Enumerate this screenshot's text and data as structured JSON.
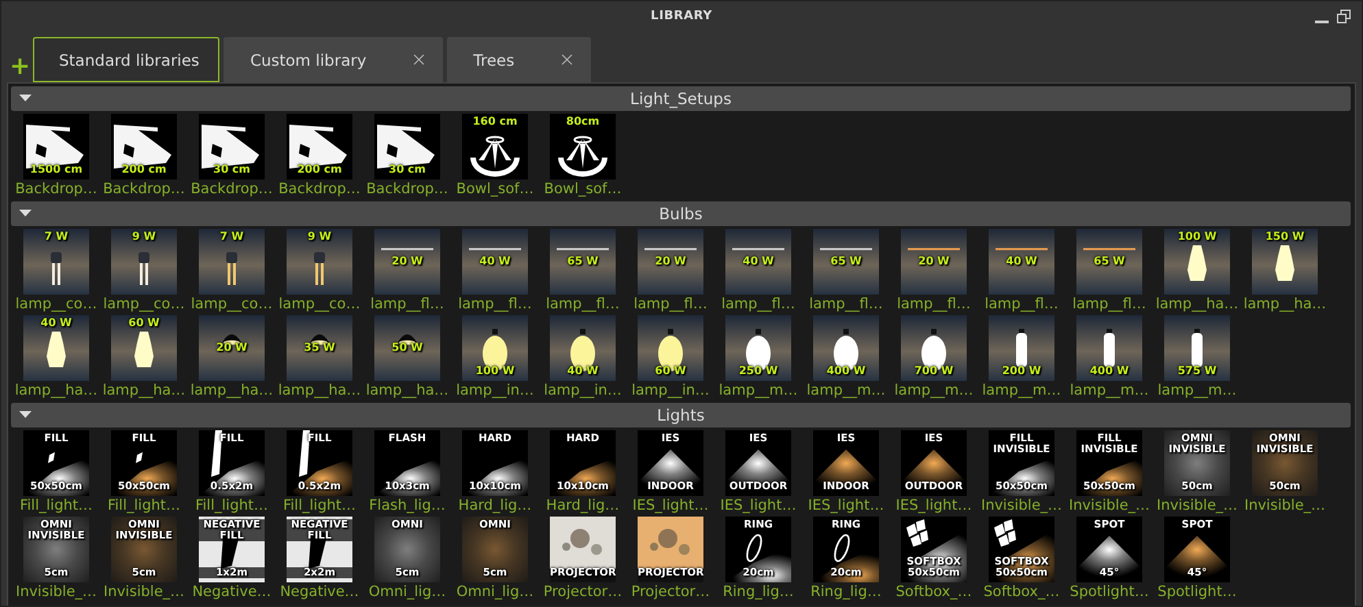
{
  "window": {
    "title": "LIBRARY"
  },
  "add_tab": "+",
  "tabs": [
    {
      "label": "Standard libraries",
      "selected": true,
      "closable": false
    },
    {
      "label": "Custom library",
      "selected": false,
      "closable": true
    },
    {
      "label": "Trees",
      "selected": false,
      "closable": true
    }
  ],
  "sections": [
    {
      "title": "Light_Setups",
      "expanded": true,
      "items": [
        {
          "label": "Backdrop…",
          "kind": "backdrop",
          "warm": false,
          "bottom": "1500 cm"
        },
        {
          "label": "Backdrop…",
          "kind": "backdrop",
          "warm": false,
          "bottom": "200 cm"
        },
        {
          "label": "Backdrop…",
          "kind": "backdrop",
          "warm": false,
          "bottom": "30 cm"
        },
        {
          "label": "Backdrop…",
          "kind": "backdrop",
          "warm": false,
          "bottom": "200 cm"
        },
        {
          "label": "Backdrop…",
          "kind": "backdrop",
          "warm": false,
          "bottom": "30 cm"
        },
        {
          "label": "Bowl_sof…",
          "kind": "bowl",
          "warm": false,
          "top": "160 cm"
        },
        {
          "label": "Bowl_sof…",
          "kind": "bowl",
          "warm": false,
          "top": "80cm"
        }
      ]
    },
    {
      "title": "Bulbs",
      "expanded": true,
      "items": [
        {
          "label": "lamp__co…",
          "kind": "cfl",
          "warm": false,
          "top": "7 W"
        },
        {
          "label": "lamp__co…",
          "kind": "cfl",
          "warm": false,
          "top": "9 W"
        },
        {
          "label": "lamp__co…",
          "kind": "cfl",
          "warm": true,
          "top": "7 W"
        },
        {
          "label": "lamp__co…",
          "kind": "cfl",
          "warm": true,
          "top": "9 W"
        },
        {
          "label": "lamp__fl…",
          "kind": "tube",
          "warm": false,
          "middle": "20 W"
        },
        {
          "label": "lamp__fl…",
          "kind": "tube",
          "warm": false,
          "middle": "40 W"
        },
        {
          "label": "lamp__fl…",
          "kind": "tube",
          "warm": false,
          "middle": "65 W"
        },
        {
          "label": "lamp__fl…",
          "kind": "tube",
          "warm": false,
          "middle": "20 W"
        },
        {
          "label": "lamp__fl…",
          "kind": "tube",
          "warm": false,
          "middle": "40 W"
        },
        {
          "label": "lamp__fl…",
          "kind": "tube",
          "warm": false,
          "middle": "65 W"
        },
        {
          "label": "lamp__fl…",
          "kind": "tube",
          "warm": true,
          "middle": "20 W"
        },
        {
          "label": "lamp__fl…",
          "kind": "tube",
          "warm": true,
          "middle": "40 W"
        },
        {
          "label": "lamp__fl…",
          "kind": "tube",
          "warm": true,
          "middle": "65 W"
        },
        {
          "label": "lamp__ha…",
          "kind": "halogen",
          "warm": false,
          "top": "100 W"
        },
        {
          "label": "lamp__ha…",
          "kind": "halogen",
          "warm": false,
          "top": "150 W"
        },
        {
          "label": "lamp__ha…",
          "kind": "halogen",
          "warm": false,
          "top": "40 W"
        },
        {
          "label": "lamp__ha…",
          "kind": "halogen",
          "warm": false,
          "top": "60 W"
        },
        {
          "label": "lamp__ha…",
          "kind": "spotbulb",
          "warm": false,
          "middle": "20 W"
        },
        {
          "label": "lamp__ha…",
          "kind": "spotbulb",
          "warm": false,
          "middle": "35 W"
        },
        {
          "label": "lamp__ha…",
          "kind": "spotbulb",
          "warm": false,
          "middle": "50 W"
        },
        {
          "label": "lamp__in…",
          "kind": "pear",
          "warm": true,
          "bottom": "100 W"
        },
        {
          "label": "lamp__in…",
          "kind": "pear",
          "warm": true,
          "bottom": "40 W"
        },
        {
          "label": "lamp__in…",
          "kind": "pear",
          "warm": true,
          "bottom": "60 W"
        },
        {
          "label": "lamp__m…",
          "kind": "pear",
          "warm": false,
          "bottom": "250 W"
        },
        {
          "label": "lamp__m…",
          "kind": "pear",
          "warm": false,
          "bottom": "400 W"
        },
        {
          "label": "lamp__m…",
          "kind": "pear",
          "warm": false,
          "bottom": "700 W"
        },
        {
          "label": "lamp__m…",
          "kind": "rod",
          "warm": false,
          "bottom": "200 W"
        },
        {
          "label": "lamp__m…",
          "kind": "rod",
          "warm": false,
          "bottom": "400 W"
        },
        {
          "label": "lamp__m…",
          "kind": "rod",
          "warm": false,
          "bottom": "575 W"
        }
      ]
    },
    {
      "title": "Lights",
      "expanded": true,
      "items": [
        {
          "label": "Fill_light…",
          "kind": "panel",
          "warm": false,
          "top": "FILL",
          "bottom": "50x50cm"
        },
        {
          "label": "Fill_light…",
          "kind": "panel",
          "warm": true,
          "top": "FILL",
          "bottom": "50x50cm"
        },
        {
          "label": "Fill_light…",
          "kind": "strip",
          "warm": false,
          "top": "FILL",
          "bottom": "0.5x2m"
        },
        {
          "label": "Fill_light…",
          "kind": "strip",
          "warm": true,
          "top": "FILL",
          "bottom": "0.5x2m"
        },
        {
          "label": "Flash_lig…",
          "kind": "glow",
          "warm": false,
          "top": "FLASH",
          "bottom": "10x3cm"
        },
        {
          "label": "Hard_lig…",
          "kind": "glow",
          "warm": false,
          "top": "HARD",
          "bottom": "10x10cm"
        },
        {
          "label": "Hard_lig…",
          "kind": "glow",
          "warm": true,
          "top": "HARD",
          "bottom": "10x10cm"
        },
        {
          "label": "IES_light…",
          "kind": "cone",
          "warm": false,
          "top": "IES",
          "bottom": "INDOOR"
        },
        {
          "label": "IES_light…",
          "kind": "cone",
          "warm": false,
          "top": "IES",
          "bottom": "OUTDOOR"
        },
        {
          "label": "IES_light…",
          "kind": "cone",
          "warm": true,
          "top": "IES",
          "bottom": "INDOOR"
        },
        {
          "label": "IES_light…",
          "kind": "cone",
          "warm": true,
          "top": "IES",
          "bottom": "OUTDOOR"
        },
        {
          "label": "Invisible_…",
          "kind": "glow",
          "warm": false,
          "top": "FILL INVISIBLE",
          "bottom": "50x50cm"
        },
        {
          "label": "Invisible_…",
          "kind": "glow",
          "warm": true,
          "top": "FILL INVISIBLE",
          "bottom": "50x50cm"
        },
        {
          "label": "Invisible_…",
          "kind": "omni",
          "warm": false,
          "top": "OMNI INVISIBLE",
          "bottom": "50cm"
        },
        {
          "label": "Invisible_…",
          "kind": "omni",
          "warm": true,
          "top": "OMNI INVISIBLE",
          "bottom": "50cm"
        },
        {
          "label": "Invisible_…",
          "kind": "omni",
          "warm": false,
          "top": "OMNI INVISIBLE",
          "bottom": "5cm"
        },
        {
          "label": "Invisible_…",
          "kind": "omni",
          "warm": true,
          "top": "OMNI INVISIBLE",
          "bottom": "5cm"
        },
        {
          "label": "Negative…",
          "kind": "negative",
          "warm": false,
          "top": "NEGATIVE FILL",
          "bottom": "1x2m"
        },
        {
          "label": "Negative…",
          "kind": "negative",
          "warm": false,
          "top": "NEGATIVE FILL",
          "bottom": "2x2m"
        },
        {
          "label": "Omni_lig…",
          "kind": "omni",
          "warm": false,
          "top": "OMNI",
          "bottom": "5cm"
        },
        {
          "label": "Omni_lig…",
          "kind": "omni",
          "warm": true,
          "top": "OMNI",
          "bottom": "5cm"
        },
        {
          "label": "Projector…",
          "kind": "projector",
          "warm": false,
          "bottom": "PROJECTOR"
        },
        {
          "label": "Projector…",
          "kind": "projector",
          "warm": true,
          "bottom": "PROJECTOR"
        },
        {
          "label": "Ring_lig…",
          "kind": "ring",
          "warm": false,
          "top": "RING",
          "bottom": "20cm"
        },
        {
          "label": "Ring_lig…",
          "kind": "ring",
          "warm": true,
          "top": "RING",
          "bottom": "20cm"
        },
        {
          "label": "Softbox_…",
          "kind": "softbox",
          "warm": false,
          "bottom": "SOFTBOX 50x50cm"
        },
        {
          "label": "Softbox_…",
          "kind": "softbox",
          "warm": true,
          "bottom": "SOFTBOX 50x50cm"
        },
        {
          "label": "Spotlight…",
          "kind": "cone",
          "warm": false,
          "top": "SPOT",
          "bottom": "45°"
        },
        {
          "label": "Spotlight…",
          "kind": "cone",
          "warm": true,
          "top": "SPOT",
          "bottom": "45°"
        }
      ]
    }
  ]
}
